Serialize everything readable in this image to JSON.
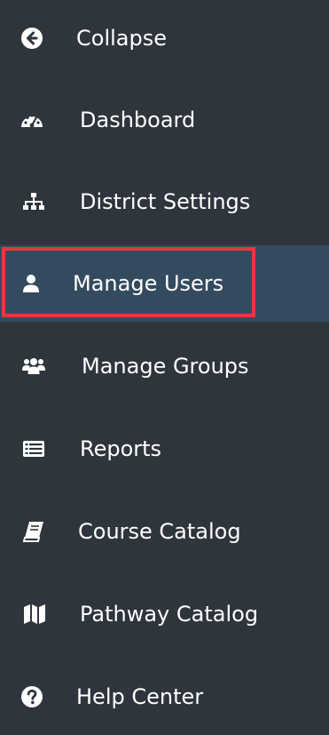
{
  "sidebar": {
    "items": [
      {
        "label": "Collapse",
        "icon": "arrow-left-circle-icon"
      },
      {
        "label": "Dashboard",
        "icon": "tachometer-icon"
      },
      {
        "label": "District Settings",
        "icon": "sitemap-icon"
      },
      {
        "label": "Manage Users",
        "icon": "user-icon"
      },
      {
        "label": "Manage Groups",
        "icon": "users-icon"
      },
      {
        "label": "Reports",
        "icon": "list-report-icon"
      },
      {
        "label": "Course Catalog",
        "icon": "book-icon"
      },
      {
        "label": "Pathway Catalog",
        "icon": "map-icon"
      },
      {
        "label": "Help Center",
        "icon": "question-circle-icon"
      }
    ],
    "active_index": 3
  },
  "colors": {
    "background": "#2f353d",
    "active_background": "#344b5f",
    "highlight_border": "#e8373f",
    "text": "#ffffff"
  }
}
